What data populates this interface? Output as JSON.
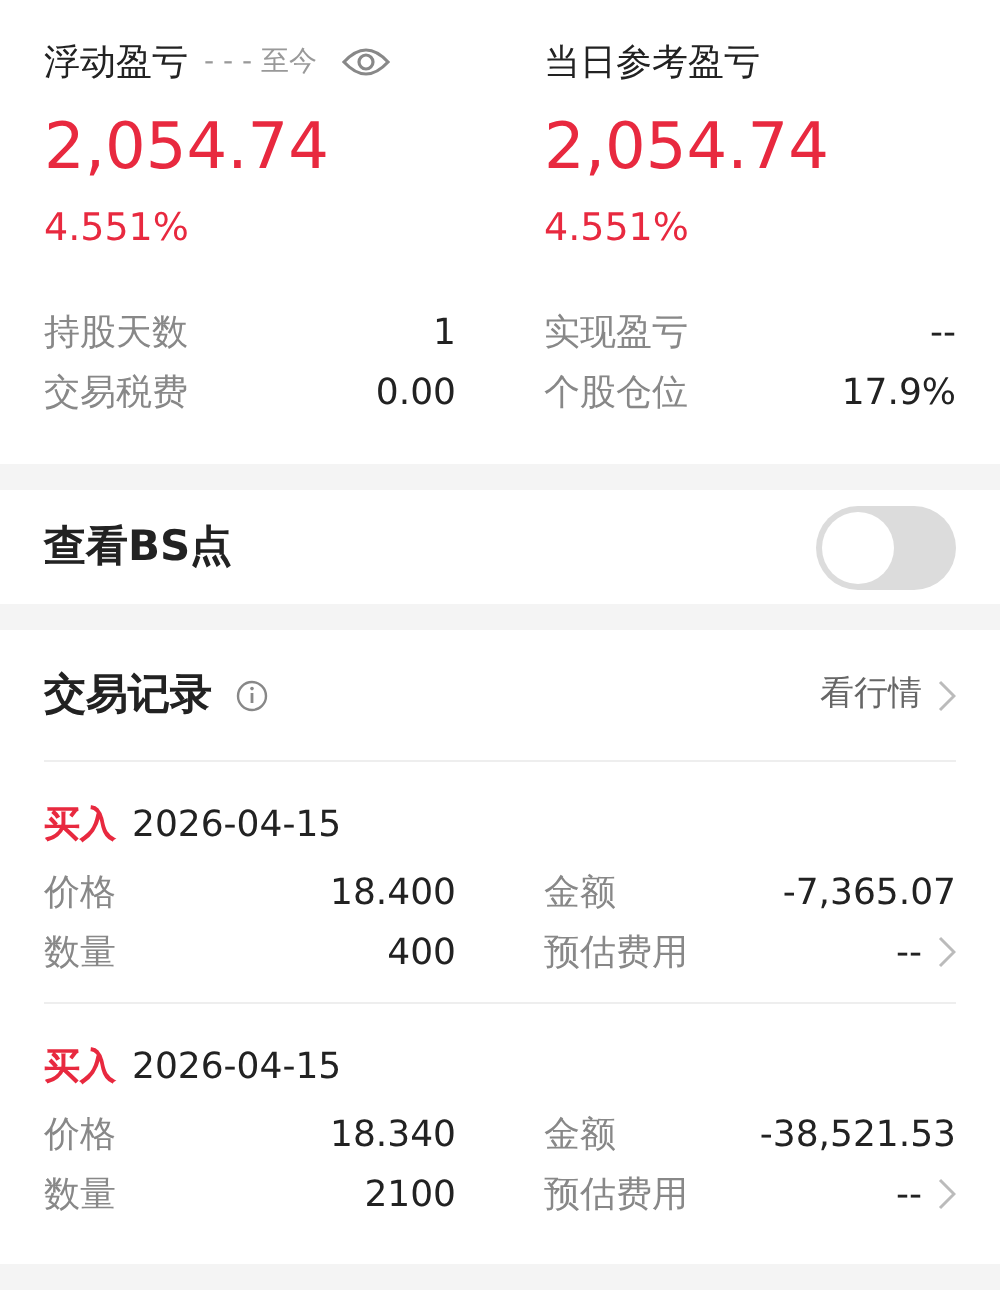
{
  "summary": [
    {
      "label": "浮动盈亏",
      "period": "- - - 至今",
      "eye": true,
      "value": "2,054.74",
      "percent": "4.551%"
    },
    {
      "label": "当日参考盈亏",
      "value": "2,054.74",
      "percent": "4.551%"
    }
  ],
  "stats": [
    {
      "label": "持股天数",
      "value": "1"
    },
    {
      "label": "实现盈亏",
      "value": "--"
    },
    {
      "label": "交易税费",
      "value": "0.00"
    },
    {
      "label": "个股仓位",
      "value": "17.9%"
    }
  ],
  "bs_toggle": {
    "label": "查看BS点",
    "on": false
  },
  "records": {
    "title": "交易记录",
    "link": "看行情",
    "trades": [
      {
        "side": "买入",
        "date": "2026-04-15",
        "fields": [
          {
            "label": "价格",
            "value": "18.400"
          },
          {
            "label": "金额",
            "value": "-7,365.07"
          },
          {
            "label": "数量",
            "value": "400"
          },
          {
            "label": "预估费用",
            "value": "--",
            "link": true
          }
        ]
      },
      {
        "side": "买入",
        "date": "2026-04-15",
        "fields": [
          {
            "label": "价格",
            "value": "18.340"
          },
          {
            "label": "金额",
            "value": "-38,521.53"
          },
          {
            "label": "数量",
            "value": "2100"
          },
          {
            "label": "预估费用",
            "value": "--",
            "link": true
          }
        ]
      }
    ]
  }
}
